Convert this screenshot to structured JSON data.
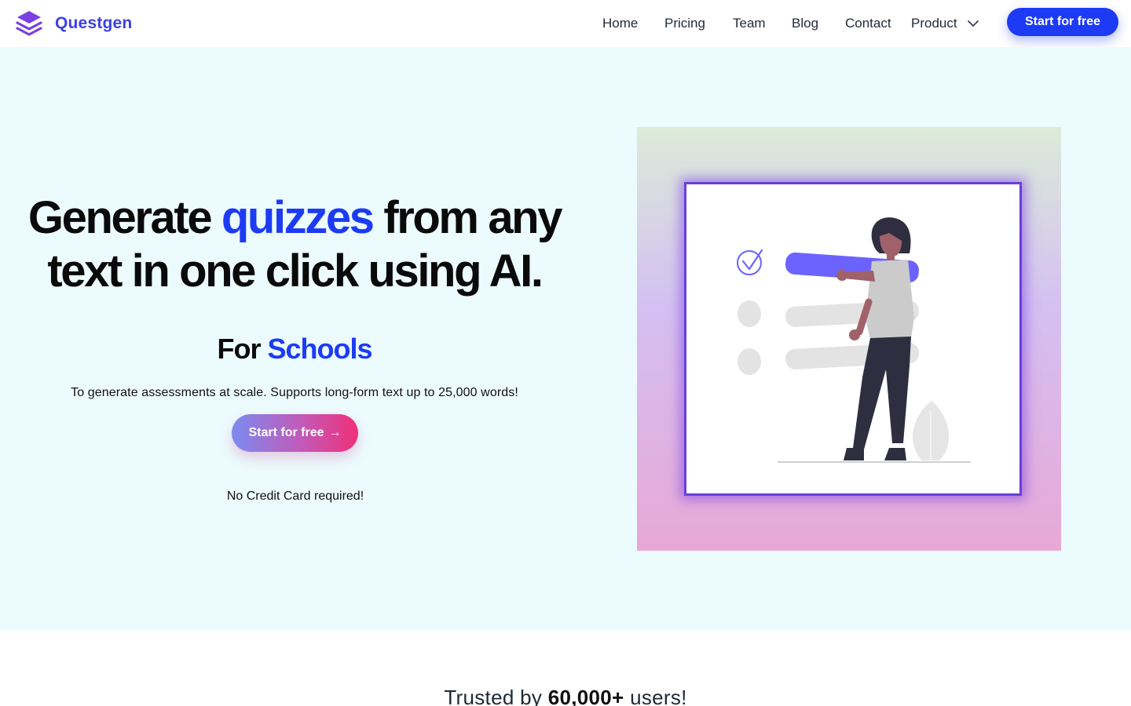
{
  "nav": {
    "brand": "Questgen",
    "links": [
      "Home",
      "Pricing",
      "Team",
      "Blog",
      "Contact"
    ],
    "product": "Product",
    "cta": "Start for free"
  },
  "hero": {
    "headline_part1": "Generate",
    "headline_accent": "quizzes",
    "headline_part2": "from any",
    "headline_line2": "text in one click using AI.",
    "for_prefix": "For",
    "for_accent": "Schools",
    "subtext": "To generate assessments at scale. Supports long-form text up to 25,000 words!",
    "cta": "Start for free",
    "cta_arrow": "→",
    "note": "No Credit Card required!"
  },
  "trusted": {
    "prefix": "Trusted by",
    "count": "60,000+",
    "suffix": "users!"
  },
  "colors": {
    "accent": "#1d3bf5",
    "brand_text": "#3b3fe6",
    "hero_bg": "#ecfbfe",
    "illustration_purple": "#6c63ff"
  }
}
